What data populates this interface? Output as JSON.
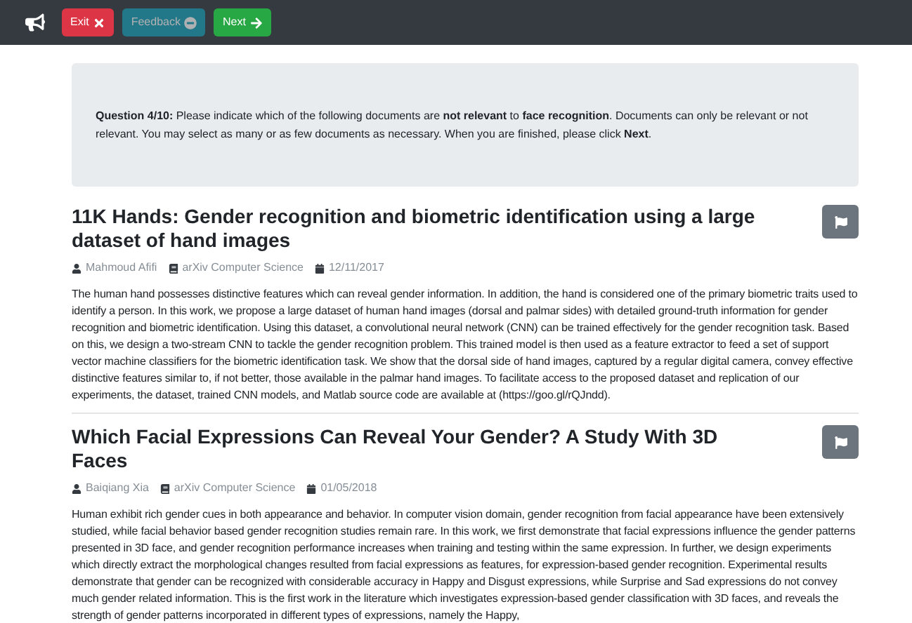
{
  "toolbar": {
    "buttons": [
      {
        "label": "Exit",
        "kind": "exit",
        "disabled": false
      },
      {
        "label": "Feedback",
        "kind": "feedback",
        "disabled": true
      },
      {
        "label": "Next",
        "kind": "next",
        "disabled": false
      }
    ]
  },
  "question": "**Question 4/10:** Please indicate which of the following documents are **not relevant** to **face recognition**. Documents can only be relevant or not relevant. You may select as many or as few documents as necessary. When you are finished, please click **Next**.",
  "documents": [
    {
      "title": "11K Hands: Gender recognition and biometric identification using a large dataset of hand images",
      "author": "Mahmoud Afifi",
      "source": "arXiv Computer Science",
      "date": "12/11/2017",
      "abstract": "The human hand possesses distinctive features which can reveal gender information. In addition, the hand is considered one of the primary biometric traits used to identify a person. In this work, we propose a large dataset of human hand images (dorsal and palmar sides) with detailed ground-truth information for gender recognition and biometric identification. Using this dataset, a convolutional neural network (CNN) can be trained effectively for the gender recognition task. Based on this, we design a two-stream CNN to tackle the gender recognition problem. This trained model is then used as a feature extractor to feed a set of support vector machine classifiers for the biometric identification task. We show that the dorsal side of hand images, captured by a regular digital camera, convey effective distinctive features similar to, if not better, those available in the palmar hand images. To facilitate access to the proposed dataset and replication of our experiments, the dataset, trained CNN models, and Matlab source code are available at (https://goo.gl/rQJndd)."
    },
    {
      "title": "Which Facial Expressions Can Reveal Your Gender? A Study With 3D Faces",
      "author": "Baiqiang Xia",
      "source": "arXiv Computer Science",
      "date": "01/05/2018",
      "abstract": "Human exhibit rich gender cues in both appearance and behavior. In computer vision domain, gender recognition from facial appearance have been extensively studied, while facial behavior based gender recognition studies remain rare. In this work, we first demonstrate that facial expressions influence the gender patterns presented in 3D face, and gender recognition performance increases when training and testing within the same expression. In further, we design experiments which directly extract the morphological changes resulted from facial expressions as features, for expression-based gender recognition. Experimental results demonstrate that gender can be recognized with considerable accuracy in Happy and Disgust expressions, while Surprise and Sad expressions do not convey much gender related information. This is the first work in the literature which investigates expression-based gender classification with 3D faces, and reveals the strength of gender patterns incorporated in different types of expressions, namely the Happy,"
    }
  ]
}
